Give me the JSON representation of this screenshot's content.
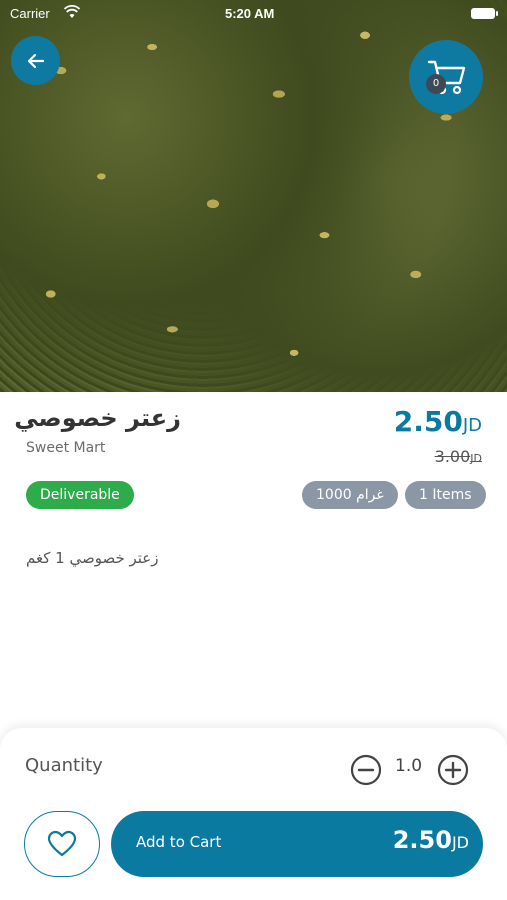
{
  "status_bar": {
    "carrier": "Carrier",
    "time": "5:20 AM"
  },
  "cart": {
    "count": "0"
  },
  "product": {
    "title": "زعتر خصوصي",
    "store": "Sweet Mart",
    "price": "2.50",
    "old_price": "3.00",
    "currency": "JD",
    "description": "زعتر خصوصي 1 كغم"
  },
  "badges": {
    "deliverable": "Deliverable",
    "weight": "غرام 1000",
    "items": "1 Items"
  },
  "bottom": {
    "quantity_label": "Quantity",
    "quantity_value": "1.0",
    "add_to_cart_label": "Add to Cart",
    "add_to_cart_price": "2.50",
    "currency": "JD"
  },
  "colors": {
    "primary": "#0b7aa0",
    "deliverable": "#2eab4a",
    "pill": "#8c97a6"
  },
  "icons": [
    "wifi-icon",
    "battery-icon",
    "arrow-left-icon",
    "cart-icon",
    "minus-circle-icon",
    "plus-circle-icon",
    "heart-icon"
  ]
}
